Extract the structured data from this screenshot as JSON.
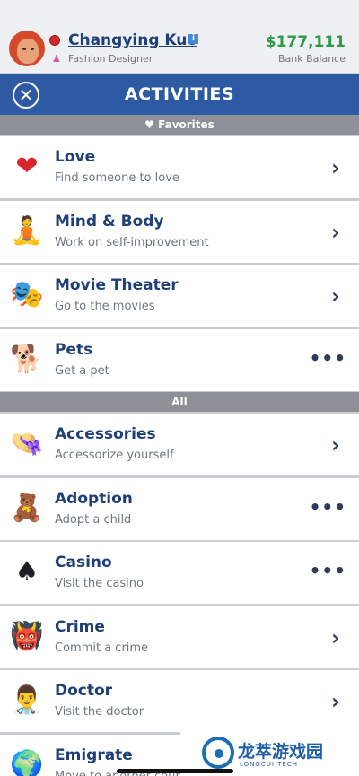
{
  "profile": {
    "name": "Changying Kuo",
    "job": "Fashion Designer",
    "balance": "$177,111",
    "balance_label": "Bank Balance",
    "info_badge": "i"
  },
  "title_bar": {
    "title": "ACTIVITIES",
    "close_glyph": "✕"
  },
  "sections": {
    "favorites": "♥ Favorites",
    "all": "All"
  },
  "favorites": [
    {
      "title": "Love",
      "subtitle": "Find someone to love",
      "icon": "heart-icon",
      "glyph": "❤",
      "action": "chevron"
    },
    {
      "title": "Mind & Body",
      "subtitle": "Work on self-improvement",
      "icon": "meditation-icon",
      "glyph": "🧘",
      "action": "chevron"
    },
    {
      "title": "Movie Theater",
      "subtitle": "Go to the movies",
      "icon": "theater-masks-icon",
      "glyph": "🎭",
      "action": "chevron"
    },
    {
      "title": "Pets",
      "subtitle": "Get a pet",
      "icon": "dog-icon",
      "glyph": "🐕",
      "action": "dots"
    }
  ],
  "all": [
    {
      "title": "Accessories",
      "subtitle": "Accessorize yourself",
      "icon": "hat-icon",
      "glyph": "👒",
      "action": "chevron"
    },
    {
      "title": "Adoption",
      "subtitle": "Adopt a child",
      "icon": "teddy-bear-icon",
      "glyph": "🧸",
      "action": "dots"
    },
    {
      "title": "Casino",
      "subtitle": "Visit the casino",
      "icon": "spade-icon",
      "glyph": "♠",
      "action": "dots"
    },
    {
      "title": "Crime",
      "subtitle": "Commit a crime",
      "icon": "ogre-mask-icon",
      "glyph": "👹",
      "action": "chevron"
    },
    {
      "title": "Doctor",
      "subtitle": "Visit the doctor",
      "icon": "doctor-icon",
      "glyph": "👨‍⚕️",
      "action": "chevron"
    },
    {
      "title": "Emigrate",
      "subtitle": "Move to another count",
      "icon": "globe-icon",
      "glyph": "🌍",
      "action": "none"
    }
  ],
  "glyphs": {
    "chevron": "›",
    "dots": "•••"
  },
  "colors": {
    "accent": "#2e5aa3",
    "money": "#2e9a4a",
    "title_text": "#1f3f78",
    "section_header": "#8d9096"
  },
  "watermark": {
    "text": "龙萃游戏园",
    "sub": "LONGCUI TECH"
  }
}
